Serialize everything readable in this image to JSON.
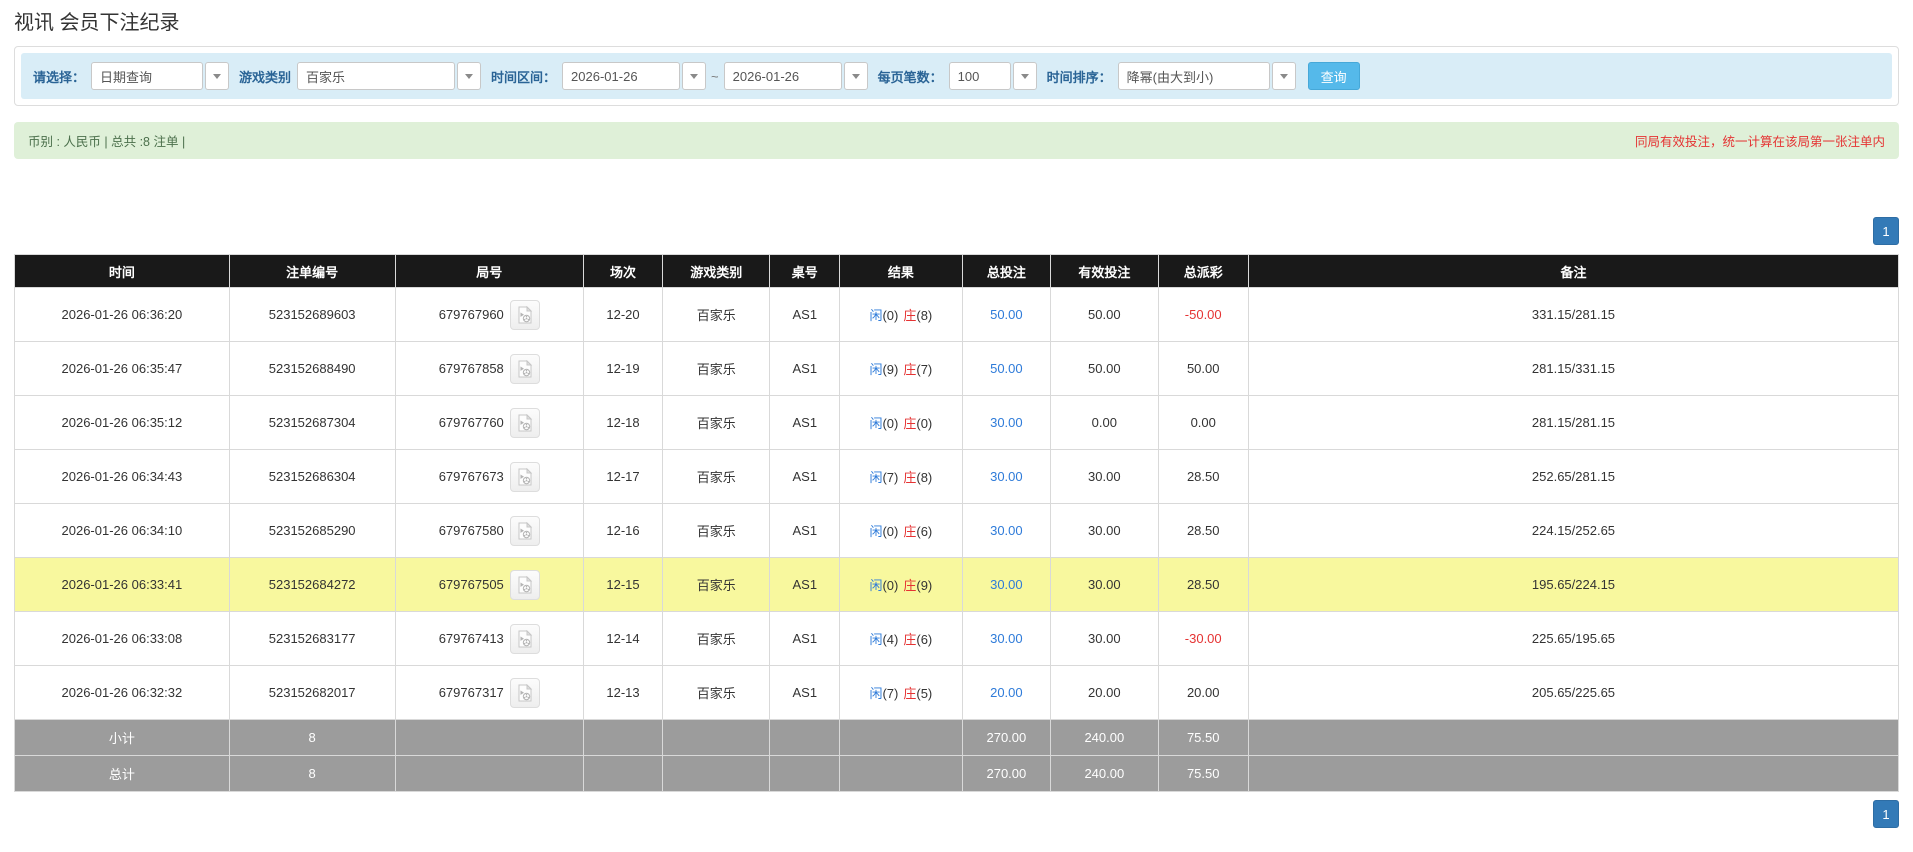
{
  "page": {
    "title": "视讯 会员下注纪录"
  },
  "filters": {
    "select_label": "请选择：",
    "select_value": "日期查询",
    "game_type_label": "游戏类别",
    "game_type_value": "百家乐",
    "time_range_label": "时间区间：",
    "date_from": "2026-01-26",
    "date_separator": "~",
    "date_to": "2026-01-26",
    "page_size_label": "每页笔数：",
    "page_size_value": "100",
    "sort_label": "时间排序：",
    "sort_value": "降幂(由大到小)",
    "query_button": "查询"
  },
  "summary": {
    "left": "币别 : 人民币 | 总共 :8 注单 |",
    "right": "同局有效投注，统一计算在该局第一张注单内"
  },
  "pagination": {
    "page": "1"
  },
  "table": {
    "headers": [
      "时间",
      "注单编号",
      "局号",
      "场次",
      "游戏类别",
      "桌号",
      "结果",
      "总投注",
      "有效投注",
      "总派彩",
      "备注"
    ],
    "rows": [
      {
        "time": "2026-01-26 06:36:20",
        "bet_no": "523152689603",
        "round_no": "679767960",
        "session": "12-20",
        "game": "百家乐",
        "table_no": "AS1",
        "player_label": "闲",
        "player_val": "(0)",
        "banker_label": "庄",
        "banker_val": "(8)",
        "total_bet": "50.00",
        "valid_bet": "50.00",
        "payout": "-50.00",
        "remark": "331.15/281.15",
        "highlight": false
      },
      {
        "time": "2026-01-26 06:35:47",
        "bet_no": "523152688490",
        "round_no": "679767858",
        "session": "12-19",
        "game": "百家乐",
        "table_no": "AS1",
        "player_label": "闲",
        "player_val": "(9)",
        "banker_label": "庄",
        "banker_val": "(7)",
        "total_bet": "50.00",
        "valid_bet": "50.00",
        "payout": "50.00",
        "remark": "281.15/331.15",
        "highlight": false
      },
      {
        "time": "2026-01-26 06:35:12",
        "bet_no": "523152687304",
        "round_no": "679767760",
        "session": "12-18",
        "game": "百家乐",
        "table_no": "AS1",
        "player_label": "闲",
        "player_val": "(0)",
        "banker_label": "庄",
        "banker_val": "(0)",
        "total_bet": "30.00",
        "valid_bet": "0.00",
        "payout": "0.00",
        "remark": "281.15/281.15",
        "highlight": false
      },
      {
        "time": "2026-01-26 06:34:43",
        "bet_no": "523152686304",
        "round_no": "679767673",
        "session": "12-17",
        "game": "百家乐",
        "table_no": "AS1",
        "player_label": "闲",
        "player_val": "(7)",
        "banker_label": "庄",
        "banker_val": "(8)",
        "total_bet": "30.00",
        "valid_bet": "30.00",
        "payout": "28.50",
        "remark": "252.65/281.15",
        "highlight": false
      },
      {
        "time": "2026-01-26 06:34:10",
        "bet_no": "523152685290",
        "round_no": "679767580",
        "session": "12-16",
        "game": "百家乐",
        "table_no": "AS1",
        "player_label": "闲",
        "player_val": "(0)",
        "banker_label": "庄",
        "banker_val": "(6)",
        "total_bet": "30.00",
        "valid_bet": "30.00",
        "payout": "28.50",
        "remark": "224.15/252.65",
        "highlight": false
      },
      {
        "time": "2026-01-26 06:33:41",
        "bet_no": "523152684272",
        "round_no": "679767505",
        "session": "12-15",
        "game": "百家乐",
        "table_no": "AS1",
        "player_label": "闲",
        "player_val": "(0)",
        "banker_label": "庄",
        "banker_val": "(9)",
        "total_bet": "30.00",
        "valid_bet": "30.00",
        "payout": "28.50",
        "remark": "195.65/224.15",
        "highlight": true
      },
      {
        "time": "2026-01-26 06:33:08",
        "bet_no": "523152683177",
        "round_no": "679767413",
        "session": "12-14",
        "game": "百家乐",
        "table_no": "AS1",
        "player_label": "闲",
        "player_val": "(4)",
        "banker_label": "庄",
        "banker_val": "(6)",
        "total_bet": "30.00",
        "valid_bet": "30.00",
        "payout": "-30.00",
        "remark": "225.65/195.65",
        "highlight": false
      },
      {
        "time": "2026-01-26 06:32:32",
        "bet_no": "523152682017",
        "round_no": "679767317",
        "session": "12-13",
        "game": "百家乐",
        "table_no": "AS1",
        "player_label": "闲",
        "player_val": "(7)",
        "banker_label": "庄",
        "banker_val": "(5)",
        "total_bet": "20.00",
        "valid_bet": "20.00",
        "payout": "20.00",
        "remark": "205.65/225.65",
        "highlight": false
      }
    ],
    "footer": [
      {
        "label": "小计",
        "count": "8",
        "total_bet": "270.00",
        "valid_bet": "240.00",
        "payout": "75.50"
      },
      {
        "label": "总计",
        "count": "8",
        "total_bet": "270.00",
        "valid_bet": "240.00",
        "payout": "75.50"
      }
    ]
  },
  "colors": {
    "accent_blue": "#2e7bd9",
    "accent_red": "#e53333",
    "header_bg": "#191919",
    "highlight_yellow": "#f8f89e",
    "footer_gray": "#9c9c9c",
    "filter_bg": "#d9edf7",
    "summary_bg": "#dff0d8",
    "button_blue": "#55b9ea",
    "pager_blue": "#337ab7"
  }
}
